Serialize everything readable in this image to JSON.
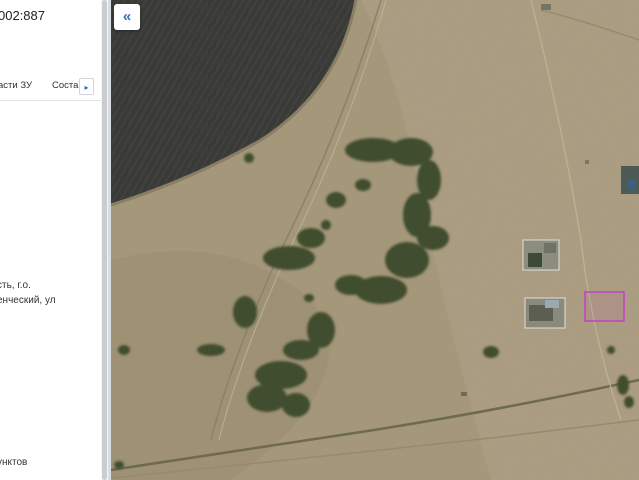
{
  "panel": {
    "cadastral_number": "002:887",
    "tabs": [
      {
        "label": "асти ЗУ"
      },
      {
        "label": "Соста"
      }
    ],
    "tab_scroll_icon": "▸",
    "address_line1": "сть, г.о.",
    "address_line2": "енческий, ул",
    "bottom_text": "унктов"
  },
  "map": {
    "collapse_icon": "«",
    "parcel_color": "#c43fc4"
  }
}
